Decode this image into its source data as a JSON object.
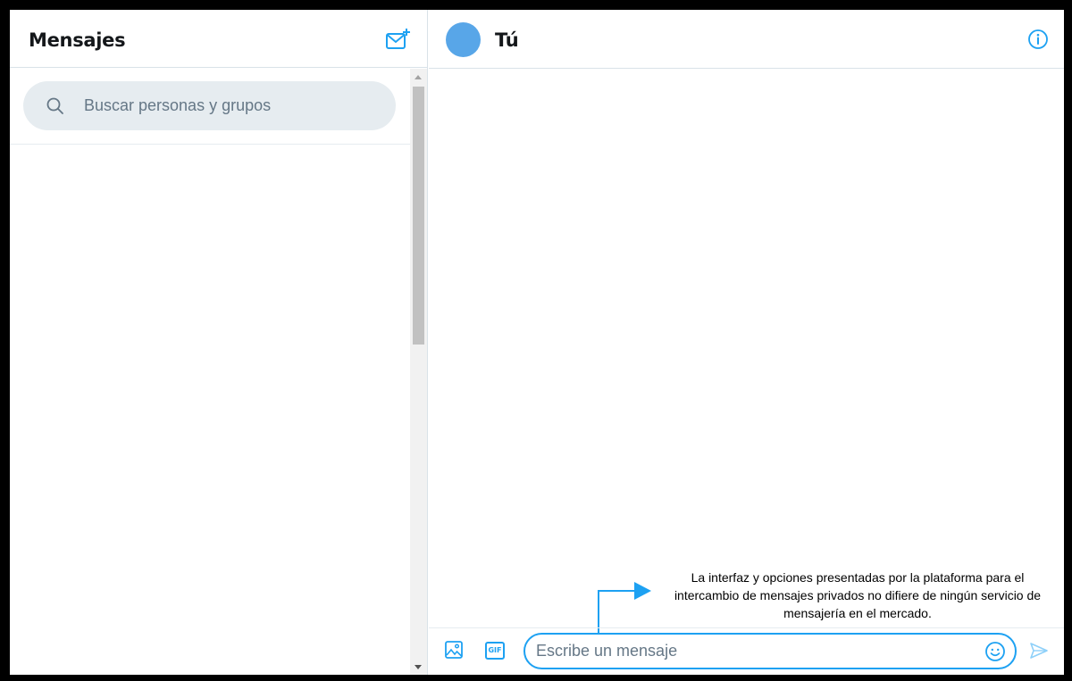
{
  "sidebar": {
    "title": "Mensajes",
    "compose_icon": "new-message-icon",
    "search": {
      "placeholder": "Buscar personas y grupos",
      "value": "",
      "icon": "search-icon"
    },
    "conversations": []
  },
  "conversation": {
    "title": "Tú",
    "avatar_color": "#58a6e8",
    "info_icon": "info-icon",
    "messages": []
  },
  "composer": {
    "placeholder": "Escribe un mensaje",
    "value": "",
    "media_icon": "image-icon",
    "gif_label": "GIF",
    "emoji_icon": "emoji-icon",
    "send_icon": "send-icon"
  },
  "annotation": {
    "text": "La interfaz y opciones presentadas por la plataforma para el intercambio de mensajes privados no difiere de ningún servicio de mensajería en el mercado."
  },
  "colors": {
    "accent": "#1da1f2",
    "search_bg": "#e6ecf0",
    "divider": "#d9e2e8",
    "text_primary": "#14171a",
    "text_secondary": "#657786"
  }
}
